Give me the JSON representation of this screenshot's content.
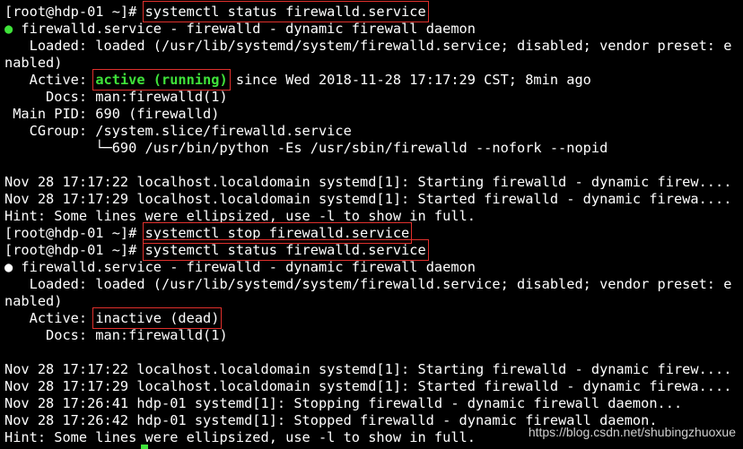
{
  "terminal": {
    "block1": {
      "prompt": "[root@hdp-01 ~]# ",
      "command": "systemctl status firewalld.service",
      "bullet": "●",
      "unit_line": " firewalld.service - firewalld - dynamic firewall daemon",
      "loaded_line1": "   Loaded: loaded (/usr/lib/systemd/system/firewalld.service; disabled; vendor preset: e",
      "loaded_line2": "nabled)",
      "active_label": "   Active: ",
      "active_state": "active (running)",
      "active_since": " since Wed 2018-11-28 17:17:29 CST; 8min ago",
      "docs_line": "     Docs: man:firewalld(1)",
      "mainpid_line": " Main PID: 690 (firewalld)",
      "cgroup_line": "   CGroup: /system.slice/firewalld.service",
      "cgroup_child": "           └─690 /usr/bin/python -Es /usr/sbin/firewalld --nofork --nopid",
      "log_lines": [
        "Nov 28 17:17:22 localhost.localdomain systemd[1]: Starting firewalld - dynamic firew....",
        "Nov 28 17:17:29 localhost.localdomain systemd[1]: Started firewalld - dynamic firewa...."
      ],
      "hint": "Hint: Some lines were ellipsized, use -l to show in full."
    },
    "stop_cmd": {
      "prompt": "[root@hdp-01 ~]# ",
      "command": "systemctl stop firewalld.service"
    },
    "block2": {
      "prompt": "[root@hdp-01 ~]# ",
      "command": "systemctl status firewalld.service",
      "bullet": "●",
      "unit_line": " firewalld.service - firewalld - dynamic firewall daemon",
      "loaded_line1": "   Loaded: loaded (/usr/lib/systemd/system/firewalld.service; disabled; vendor preset: e",
      "loaded_line2": "nabled)",
      "active_label": "   Active: ",
      "active_state": "inactive (dead)",
      "docs_line": "     Docs: man:firewalld(1)",
      "log_lines": [
        "Nov 28 17:17:22 localhost.localdomain systemd[1]: Starting firewalld - dynamic firew....",
        "Nov 28 17:17:29 localhost.localdomain systemd[1]: Started firewalld - dynamic firewa....",
        "Nov 28 17:26:41 hdp-01 systemd[1]: Stopping firewalld - dynamic firewall daemon...",
        "Nov 28 17:26:42 hdp-01 systemd[1]: Stopped firewalld - dynamic firewall daemon."
      ],
      "hint": "Hint: Some lines were ellipsized, use -l to show in full."
    },
    "colors": {
      "background": "#000000",
      "foreground": "#ffffff",
      "running_green": "#3fe23a",
      "highlight_box": "#e0302c"
    }
  },
  "watermark": "https://blog.csdn.net/shubingzhuoxue"
}
